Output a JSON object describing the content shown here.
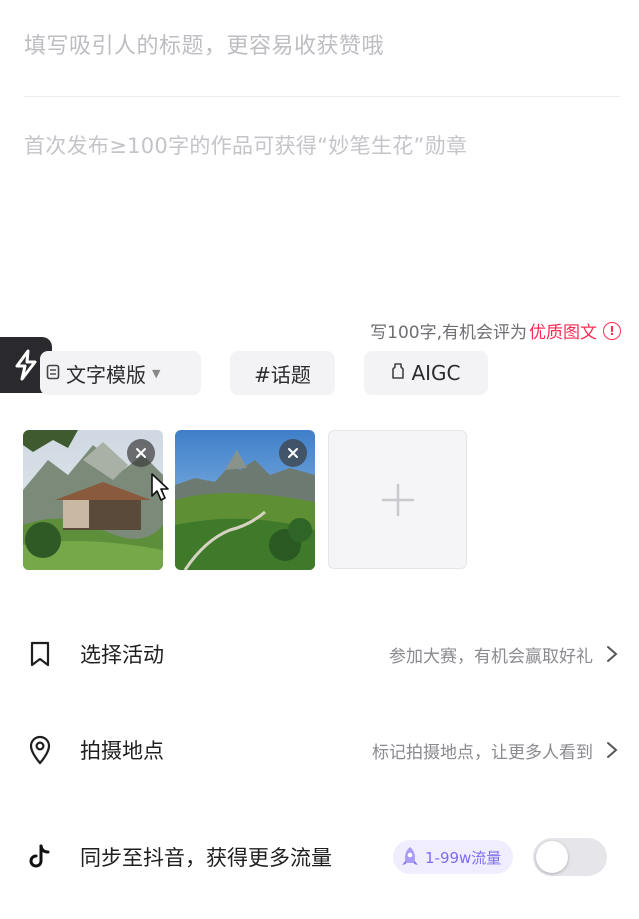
{
  "editor": {
    "title_placeholder": "填写吸引人的标题，更容易收获赞哦",
    "body_placeholder": "首次发布≥100字的作品可获得“妙笔生花”勋章",
    "hint_text": "写100字,有机会评为",
    "hint_highlight": "优质图文",
    "hint_info_glyph": "!"
  },
  "toolbar": {
    "template_label": "文字模版",
    "topic_label": "#话题",
    "aigc_label": "AIGC"
  },
  "images": {
    "items": [
      {
        "name": "mountain-hut-photo"
      },
      {
        "name": "alpine-valley-photo"
      }
    ],
    "add_glyph": "+"
  },
  "rows": {
    "activity": {
      "label": "选择活动",
      "sub": "参加大赛，有机会赢取好礼",
      "icon": "bookmark-icon"
    },
    "location": {
      "label": "拍摄地点",
      "sub": "标记拍摄地点，让更多人看到",
      "icon": "location-pin-icon"
    },
    "sync": {
      "label": "同步至抖音，获得更多流量",
      "badge": "1-99w流量",
      "icon": "tiktok-icon",
      "toggle_on": false
    }
  },
  "colors": {
    "accent": "#fe2c55",
    "badge": "#7d6cf2"
  }
}
